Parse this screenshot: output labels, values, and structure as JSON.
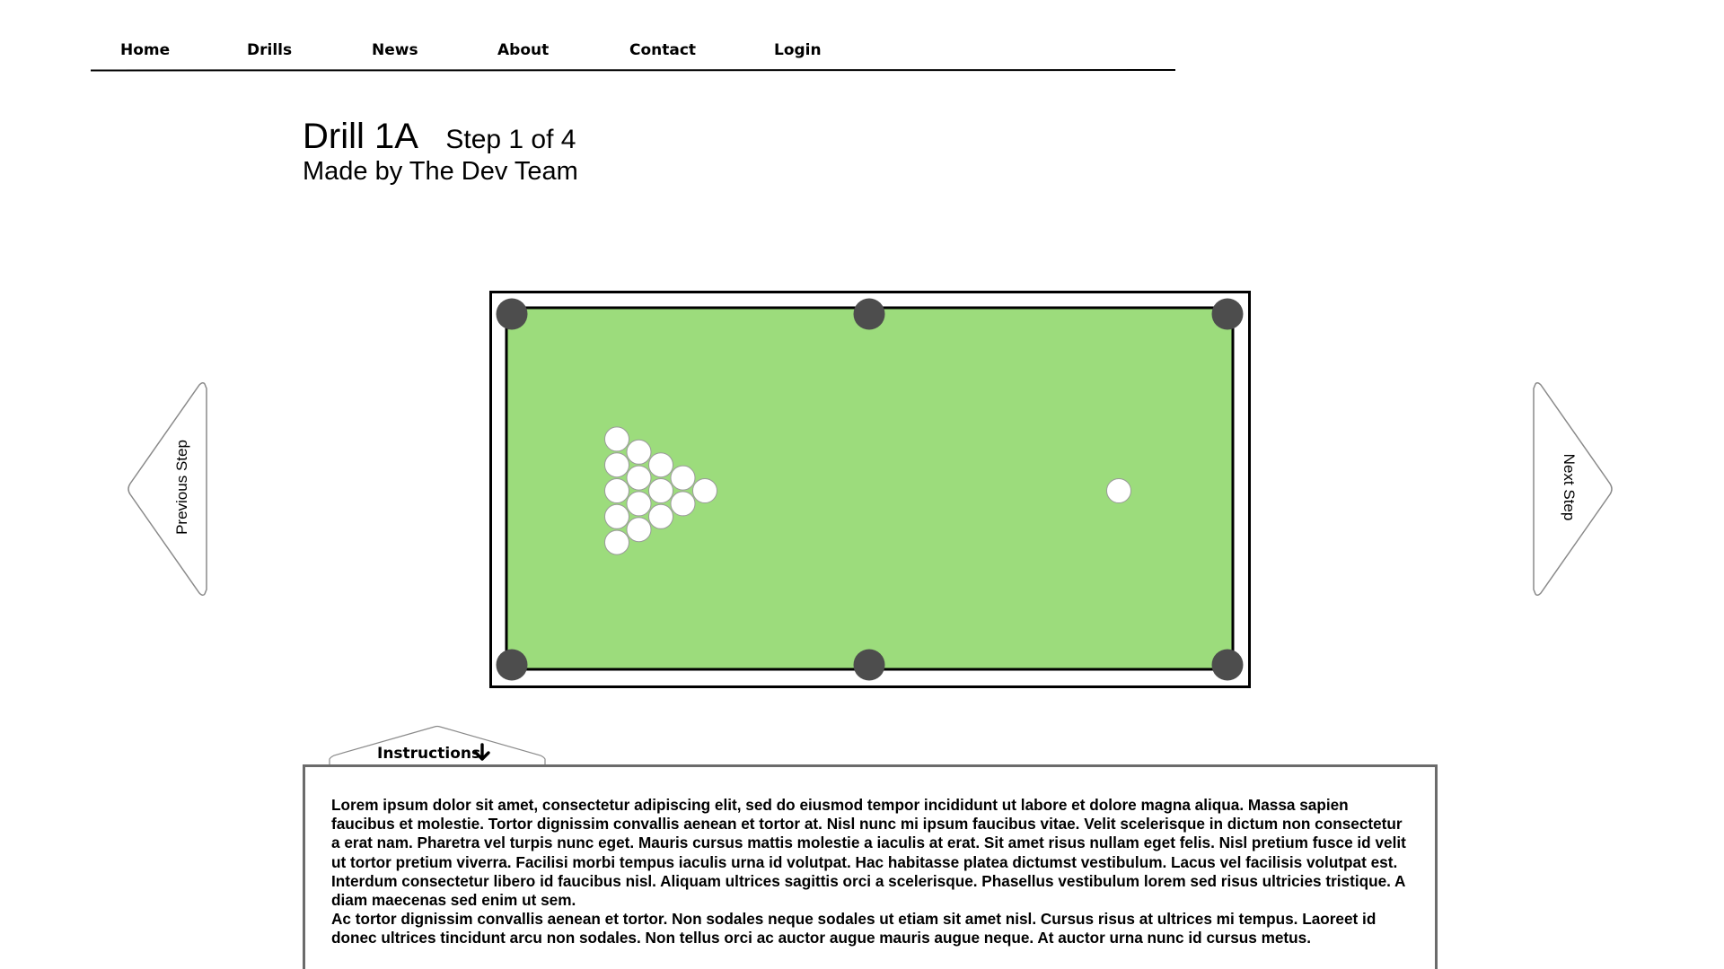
{
  "nav": {
    "items": [
      {
        "label": "Home"
      },
      {
        "label": "Drills"
      },
      {
        "label": "News"
      },
      {
        "label": "About"
      },
      {
        "label": "Contact"
      },
      {
        "label": "Login"
      }
    ]
  },
  "header": {
    "title": "Drill 1A",
    "step": "Step 1 of 4",
    "subtitle": "Made by The Dev Team"
  },
  "table": {
    "felt_color": "#9cdc7c",
    "pocket_color": "#4d4d4d",
    "ball_color": "#ffffff",
    "rack_ball_count": 15,
    "cue_ball_count": 1
  },
  "navigation": {
    "previous_label": "Previous Step",
    "next_label": "Next Step"
  },
  "instructions": {
    "tab_label": "Instructions",
    "tab_icon": "arrow-down-icon",
    "paragraphs": [
      "Lorem ipsum dolor sit amet, consectetur adipiscing elit, sed do eiusmod tempor incididunt ut labore et dolore magna aliqua. Massa sapien faucibus et molestie. Tortor dignissim convallis aenean et tortor at. Nisl nunc mi ipsum faucibus vitae. Velit scelerisque in dictum non consectetur a erat nam. Pharetra vel turpis nunc eget. Mauris cursus mattis molestie a iaculis at erat. Sit amet risus nullam eget felis. Nisl pretium fusce id velit ut tortor pretium viverra. Facilisi morbi tempus iaculis urna id volutpat. Hac habitasse platea dictumst vestibulum. Lacus vel facilisis volutpat est. Interdum consectetur libero id faucibus nisl. Aliquam ultrices sagittis orci a scelerisque. Phasellus vestibulum lorem sed risus ultricies tristique. A diam maecenas sed enim ut sem.",
      "Ac tortor dignissim convallis aenean et tortor. Non sodales neque sodales ut etiam sit amet nisl. Cursus risus at ultrices mi tempus. Laoreet id donec ultrices tincidunt arcu non sodales. Non tellus orci ac auctor augue mauris augue neque. At auctor urna nunc id cursus metus."
    ]
  }
}
